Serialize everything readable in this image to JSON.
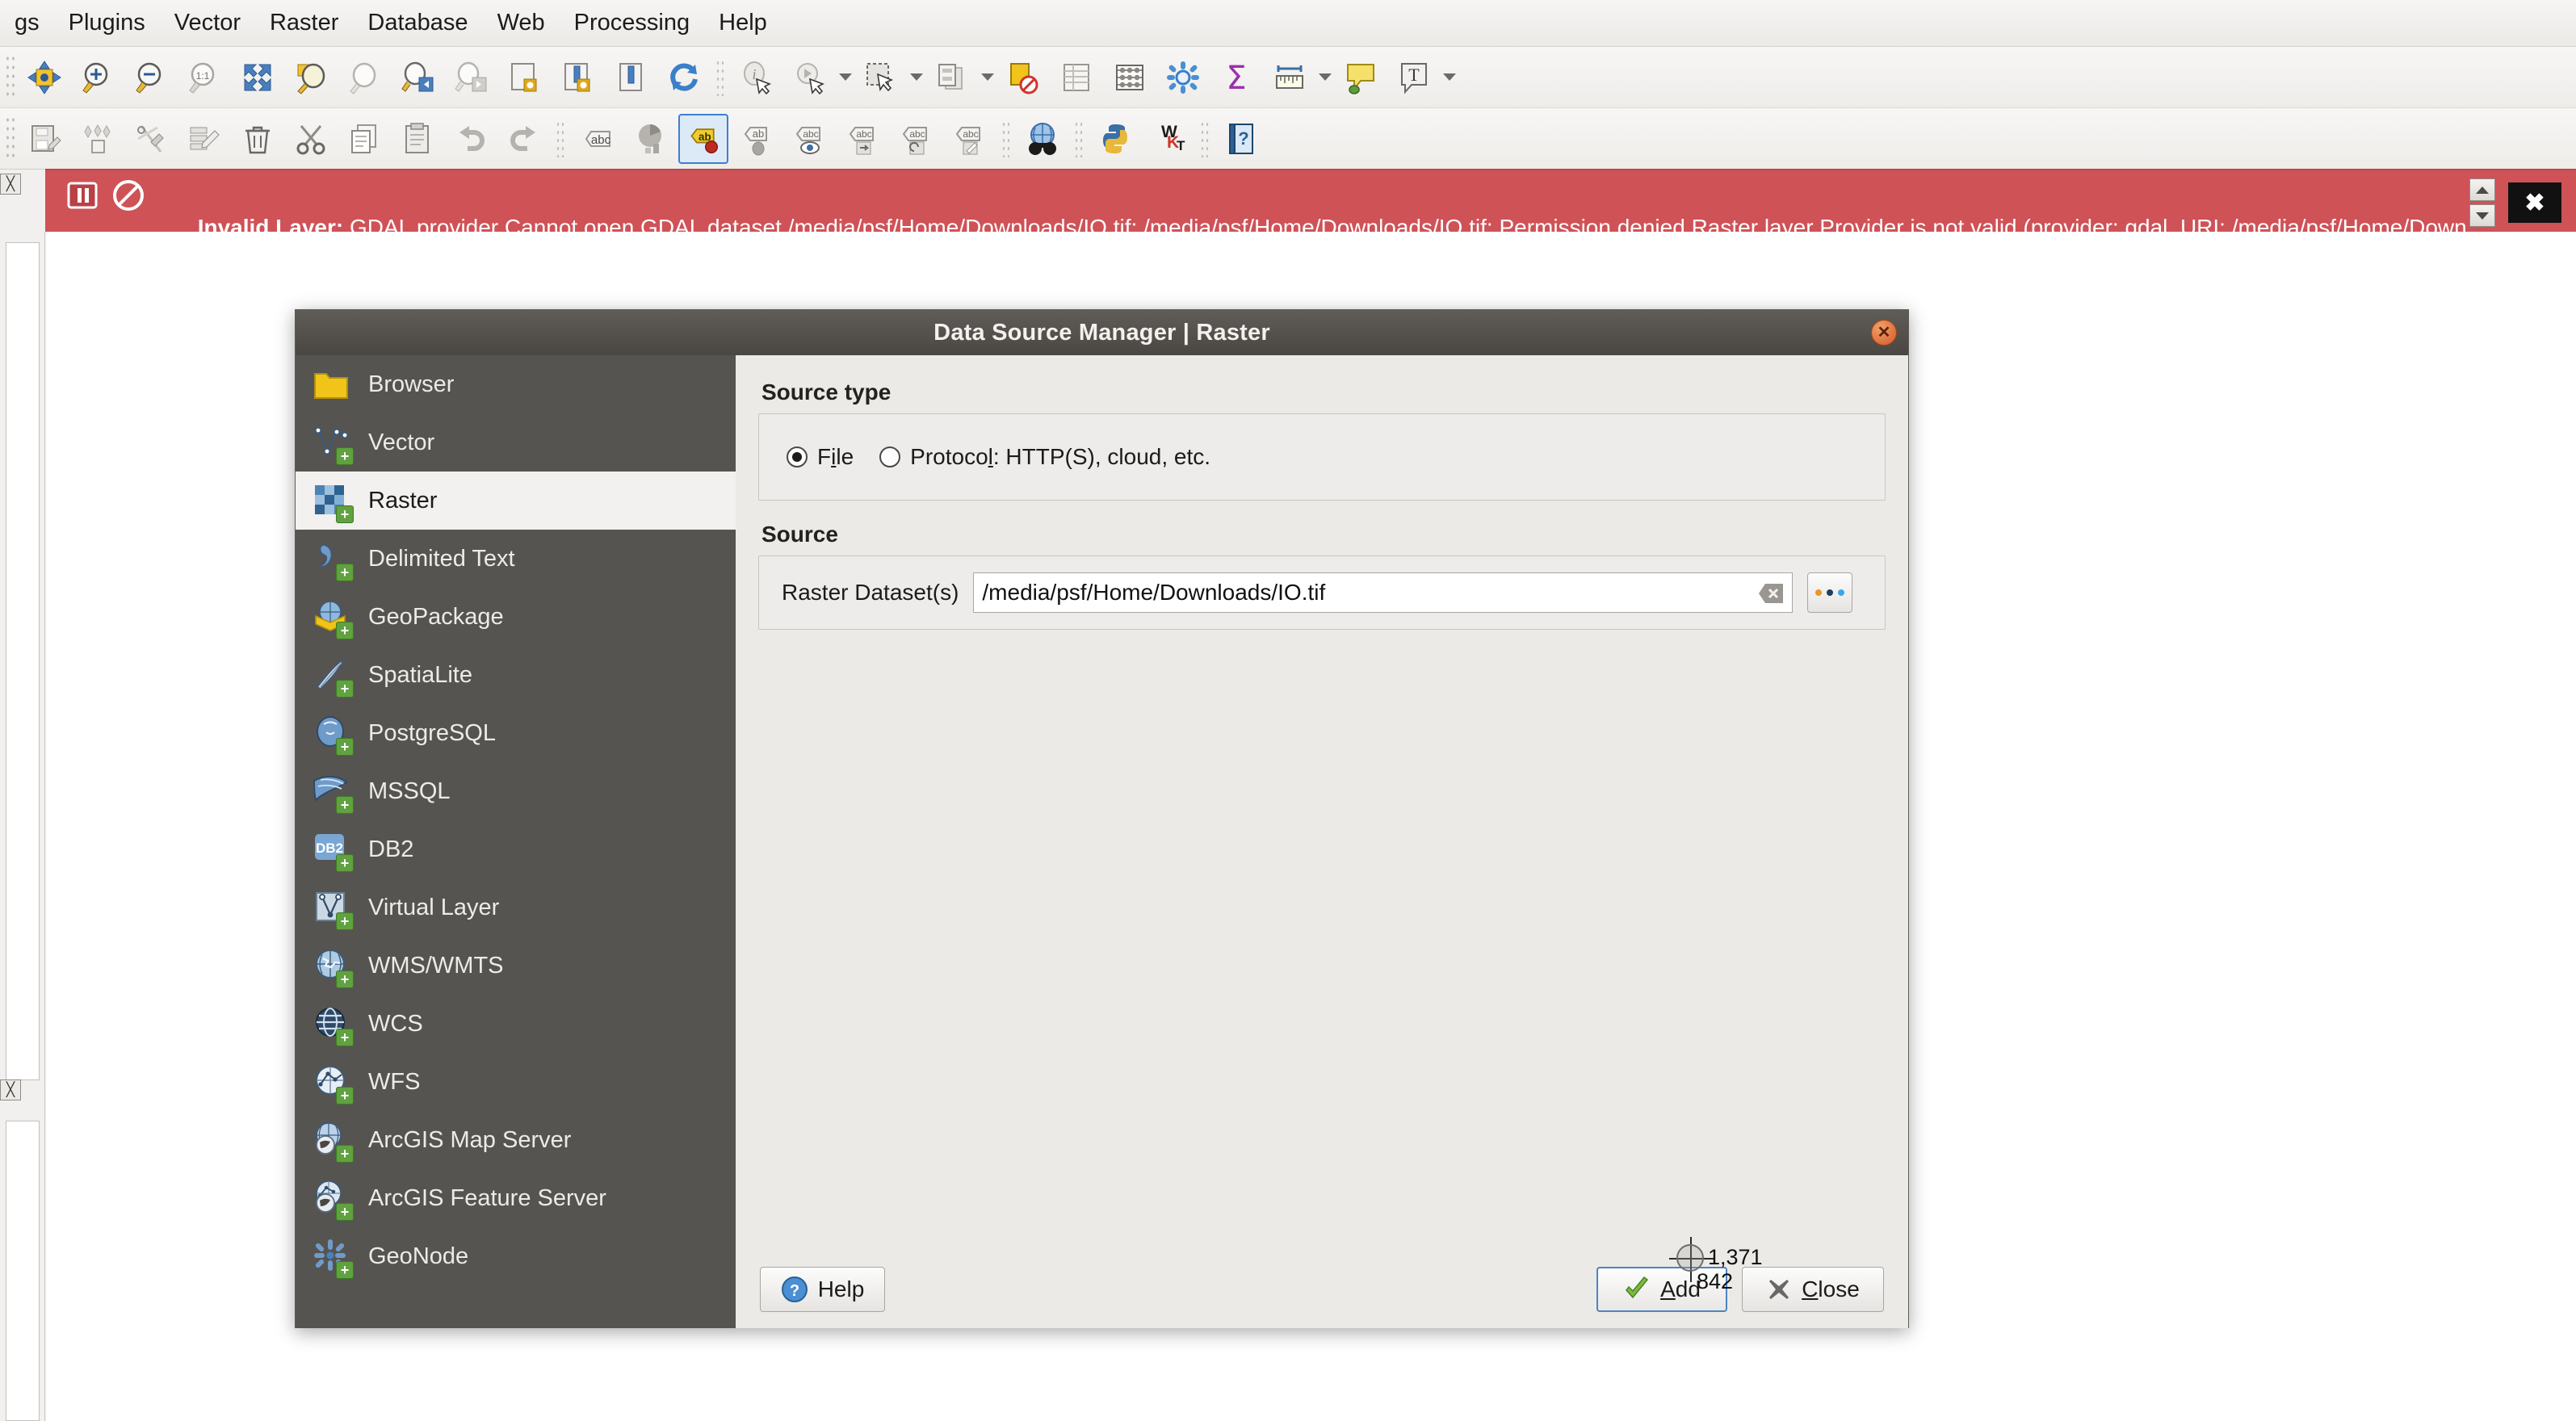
{
  "menu": {
    "items": [
      {
        "label": "gs",
        "mnemonic": ""
      },
      {
        "label": "Plugins",
        "mnemonic": "P"
      },
      {
        "label": "Vector",
        "mnemonic": "o"
      },
      {
        "label": "Raster",
        "mnemonic": "R"
      },
      {
        "label": "Database",
        "mnemonic": "D"
      },
      {
        "label": "Web",
        "mnemonic": "W"
      },
      {
        "label": "Processing",
        "mnemonic": "c"
      },
      {
        "label": "Help",
        "mnemonic": "H"
      }
    ]
  },
  "toolbar_row1": {
    "icons": [
      "pan-map-icon",
      "zoom-in-icon",
      "zoom-out-icon",
      "zoom-native-icon",
      "zoom-full-icon",
      "zoom-to-selection-icon",
      "zoom-to-layer-icon",
      "zoom-last-icon",
      "zoom-next-icon",
      "new-map-view-icon",
      "new-3d-map-view-icon",
      "new-print-layout-icon",
      "refresh-icon",
      "identify-features-icon",
      "run-feature-action-icon",
      "select-features-icon",
      "deselect-icon",
      "clear-selection-icon",
      "open-attribute-table-icon",
      "field-calculator-icon",
      "processing-toolbox-icon",
      "statistical-summary-icon",
      "measure-line-icon",
      "map-tip-icon",
      "text-annotation-icon"
    ]
  },
  "toolbar_row2": {
    "icons": [
      "save-layer-edits-icon",
      "current-edits-icon",
      "toggle-editing-icon",
      "multi-edit-icon",
      "delete-selected-icon",
      "cut-features-icon",
      "copy-features-icon",
      "paste-features-icon",
      "undo-icon",
      "redo-icon",
      "label-abc-icon",
      "layer-diagram-icon",
      "highlight-pinned-labels-icon",
      "pin-labels-icon",
      "show-hide-labels-icon",
      "move-label-icon",
      "rotate-label-icon",
      "change-label-icon",
      "metasearch-icon",
      "python-console-icon",
      "wkt-icon",
      "help-contents-icon"
    ]
  },
  "message_bar": {
    "level": "error",
    "title": "Invalid Layer:",
    "text": " GDAL provider Cannot open GDAL dataset /media/psf/Home/Downloads/IO.tif: /media/psf/Home/Downloads/IO.tif: Permission denied Raster layer Provider is not valid (provider: gdal, URI: /media/psf/Home/Downloads/IO.tif",
    "background_color": "#cf5257",
    "close_label": "✖",
    "icons": [
      "pause-icon",
      "no-entry-icon"
    ]
  },
  "dialog": {
    "title": "Data Source Manager | Raster",
    "close_button": "✕",
    "sidebar": {
      "items": [
        {
          "label": "Browser",
          "icon": "folder-icon",
          "selected": false,
          "plus": false
        },
        {
          "label": "Vector",
          "icon": "vector-layer-icon",
          "selected": false,
          "plus": true
        },
        {
          "label": "Raster",
          "icon": "raster-layer-icon",
          "selected": true,
          "plus": true
        },
        {
          "label": "Delimited Text",
          "icon": "delimited-text-icon",
          "selected": false,
          "plus": true
        },
        {
          "label": "GeoPackage",
          "icon": "geopackage-icon",
          "selected": false,
          "plus": true
        },
        {
          "label": "SpatiaLite",
          "icon": "spatialite-icon",
          "selected": false,
          "plus": true
        },
        {
          "label": "PostgreSQL",
          "icon": "postgresql-icon",
          "selected": false,
          "plus": true
        },
        {
          "label": "MSSQL",
          "icon": "mssql-icon",
          "selected": false,
          "plus": true
        },
        {
          "label": "DB2",
          "icon": "db2-icon",
          "selected": false,
          "plus": true
        },
        {
          "label": "Virtual Layer",
          "icon": "virtual-layer-icon",
          "selected": false,
          "plus": true
        },
        {
          "label": "WMS/WMTS",
          "icon": "wms-wmts-icon",
          "selected": false,
          "plus": true
        },
        {
          "label": "WCS",
          "icon": "wcs-icon",
          "selected": false,
          "plus": true
        },
        {
          "label": "WFS",
          "icon": "wfs-icon",
          "selected": false,
          "plus": true
        },
        {
          "label": "ArcGIS Map Server",
          "icon": "arcgis-map-server-icon",
          "selected": false,
          "plus": true
        },
        {
          "label": "ArcGIS Feature Server",
          "icon": "arcgis-feature-server-icon",
          "selected": false,
          "plus": true
        },
        {
          "label": "GeoNode",
          "icon": "geonode-icon",
          "selected": false,
          "plus": true
        }
      ]
    },
    "source_type": {
      "group_label": "Source type",
      "options": [
        {
          "label_pre": "F",
          "label_mn": "i",
          "label_post": "le",
          "selected": true
        },
        {
          "label_pre": "Protoco",
          "label_mn": "l",
          "label_post": ": HTTP(S), cloud, etc.",
          "selected": false
        }
      ]
    },
    "source": {
      "group_label": "Source",
      "field_label": "Raster Dataset(s)",
      "field_value": "/media/psf/Home/Downloads/IO.tif",
      "field_placeholder": "",
      "clear_icon": "clear-x-icon",
      "browse_label": "..."
    },
    "footer": {
      "help_pre": "",
      "help_label": "Help",
      "add_pre": "",
      "add_mn": "A",
      "add_post": "dd",
      "close_mn": "C",
      "close_post": "lose"
    }
  },
  "cursor": {
    "x_label": "1,371",
    "y_label": "842"
  }
}
